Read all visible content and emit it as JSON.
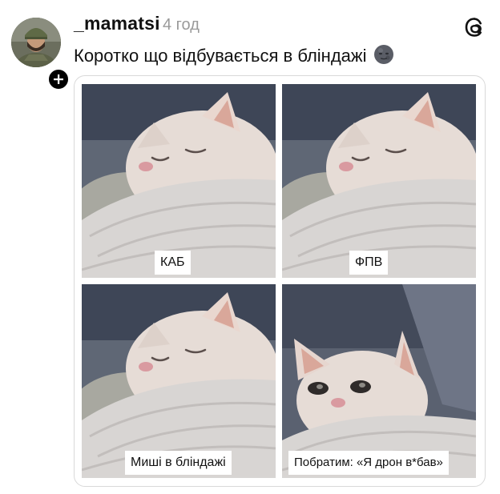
{
  "post": {
    "username": "_mamatsi",
    "timestamp": "4 год",
    "caption": "Коротко що відбувається в бліндажі",
    "caption_emoji": "new-moon-face-emoji",
    "follow_icon": "plus-icon",
    "app_icon": "threads-logo-icon"
  },
  "meme": {
    "panels": [
      {
        "label": "КАБ",
        "pose": "sleeping"
      },
      {
        "label": "ФПВ",
        "pose": "sleeping"
      },
      {
        "label": "Миші в бліндажі",
        "pose": "sleeping"
      },
      {
        "label": "Побратим: «Я дрон в*бав»",
        "pose": "awake"
      }
    ]
  },
  "colors": {
    "text": "#111111",
    "muted": "#9a9a9a",
    "badge": "#000000",
    "border": "#d9d9d9"
  }
}
